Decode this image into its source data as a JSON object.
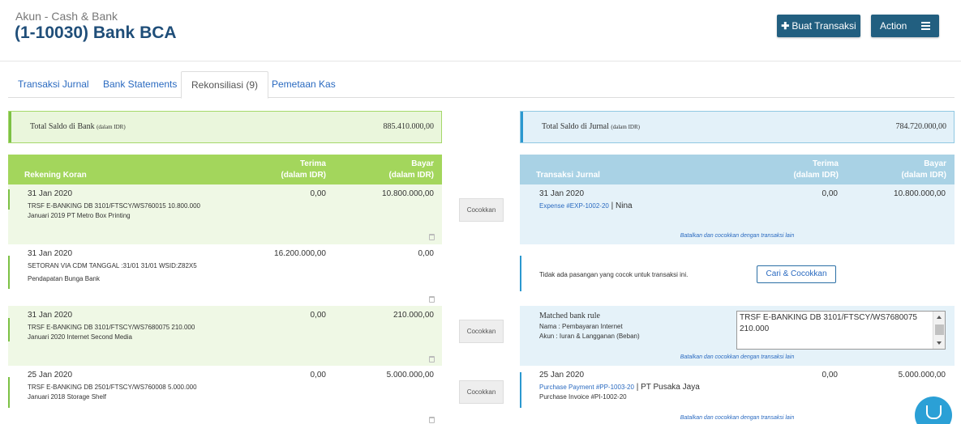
{
  "header": {
    "subtitle": "Akun - Cash & Bank",
    "title": "(1-10030) Bank BCA",
    "buat_button": "Buat Transaksi",
    "action_button": "Action"
  },
  "tabs": [
    {
      "label": "Transaksi Jurnal",
      "active": false
    },
    {
      "label": "Bank Statements",
      "active": false
    },
    {
      "label": "Rekonsiliasi (9)",
      "active": true
    },
    {
      "label": "Pemetaan Kas",
      "active": false
    }
  ],
  "left": {
    "total_label": "Total Saldo di Bank",
    "total_unit": "(dalam IDR)",
    "total_value": "885.410.000,00",
    "col_main": "Rekening Koran",
    "col_terima_1": "Terima",
    "col_terima_2": "(dalam IDR)",
    "col_bayar_1": "Bayar",
    "col_bayar_2": "(dalam IDR)",
    "rows": [
      {
        "date": "31 Jan 2020",
        "line1": "TRSF E-BANKING DB 3101/FTSCY/WS760015 10.800.000",
        "line2": "Januari 2019 PT Metro Box Printing",
        "terima": "0,00",
        "bayar": "10.800.000,00"
      },
      {
        "date": "31 Jan 2020",
        "line1": "SETORAN VIA CDM TANGGAL :31/01 31/01 WSID:Z82X5",
        "line2": "Pendapatan Bunga Bank",
        "terima": "16.200.000,00",
        "bayar": "0,00"
      },
      {
        "date": "31 Jan 2020",
        "line1": "TRSF E-BANKING DB 3101/FTSCY/WS7680075 210.000",
        "line2": "Januari 2020 Internet Second Media",
        "terima": "0,00",
        "bayar": "210.000,00"
      },
      {
        "date": "25 Jan 2020",
        "line1": "TRSF E-BANKING DB 2501/FTSCY/WS760008 5.000.000",
        "line2": "Januari 2018 Storage Shelf",
        "terima": "0,00",
        "bayar": "5.000.000,00"
      }
    ]
  },
  "match_button": "Cocokkan",
  "right": {
    "total_label": "Total Saldo di Jurnal",
    "total_unit": "(dalam IDR)",
    "total_value": "784.720.000,00",
    "col_main": "Transaksi Jurnal",
    "col_terima_1": "Terima",
    "col_terima_2": "(dalam IDR)",
    "col_bayar_1": "Bayar",
    "col_bayar_2": "(dalam IDR)",
    "cancel_note": "Batalkan dan cocokkan dengan transaksi lain",
    "row1": {
      "date": "31 Jan 2020",
      "link": "Expense #EXP-1002-20",
      "party": " | Nina",
      "terima": "0,00",
      "bayar": "10.800.000,00"
    },
    "row2": {
      "message": "Tidak ada pasangan yang cocok untuk transaksi ini.",
      "button": "Cari & Cocokkan"
    },
    "row3": {
      "title": "Matched bank rule",
      "nama": "Nama : Pembayaran Internet",
      "akun": "Akun : Iuran & Langganan (Beban)",
      "select_text": "TRSF E-BANKING DB 3101/FTSCY/WS7680075 210.000"
    },
    "row4": {
      "date": "25 Jan 2020",
      "link": "Purchase Payment #PP-1003-20",
      "party": " | PT Pusaka Jaya",
      "line2": "Purchase Invoice #PI-1002-20",
      "terima": "0,00",
      "bayar": "5.000.000,00"
    }
  },
  "colors": {
    "accent_dark": "#225f80",
    "green": "#a3d65c",
    "blue": "#a9d2e5",
    "link": "#2a6ac0"
  }
}
